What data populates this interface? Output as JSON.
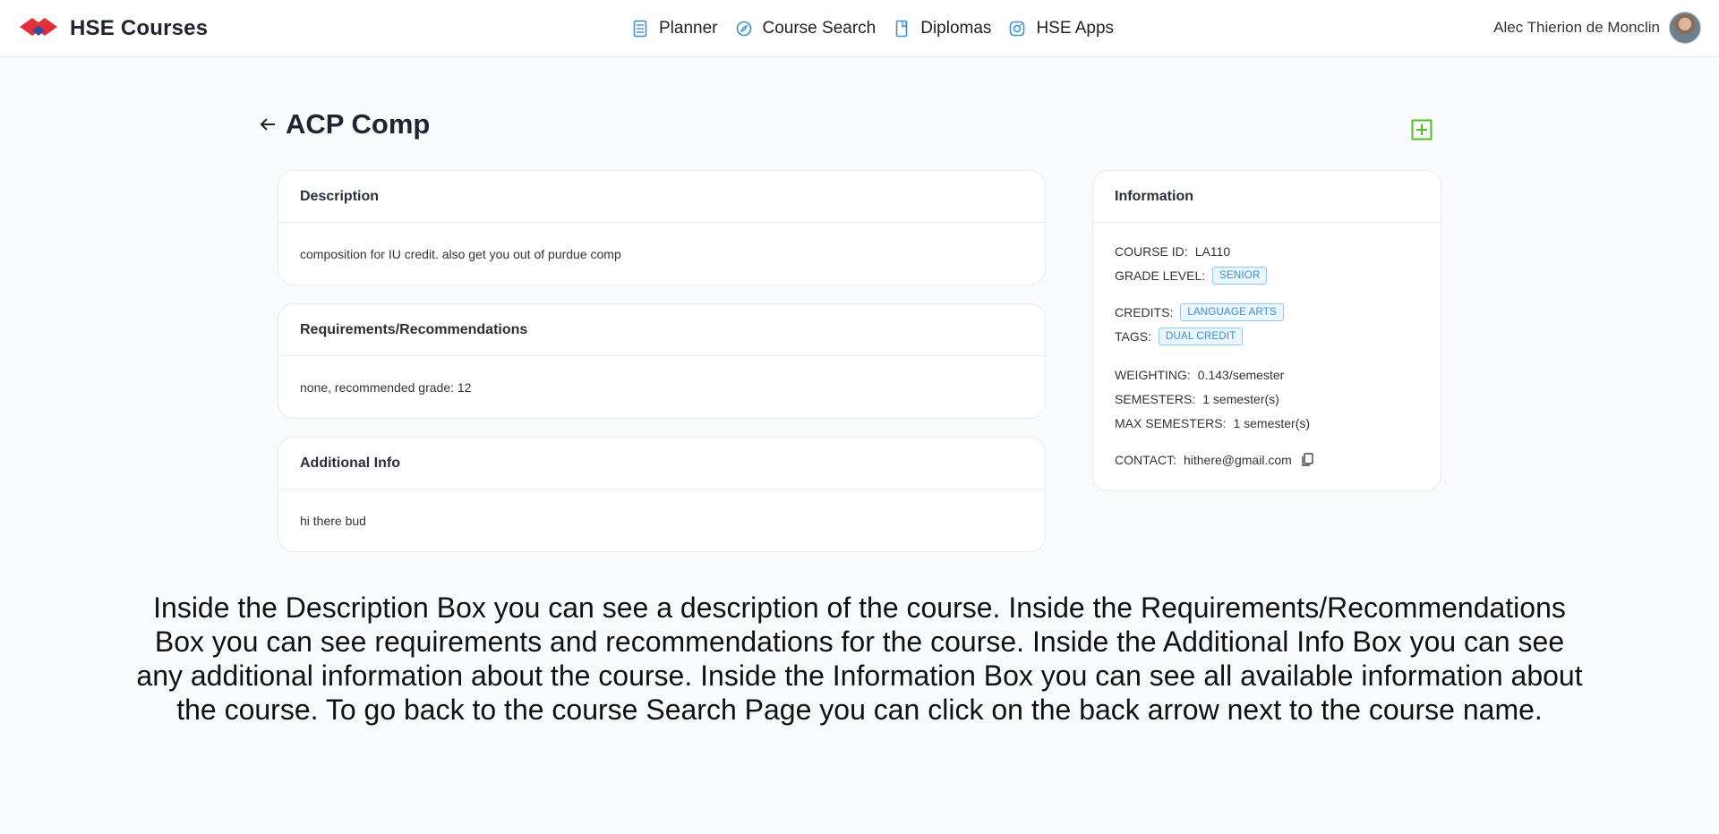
{
  "header": {
    "brand_name": "HSE Courses",
    "nav": [
      {
        "label": "Planner",
        "icon": "book-icon"
      },
      {
        "label": "Course Search",
        "icon": "compass-icon"
      },
      {
        "label": "Diplomas",
        "icon": "bookmark-icon"
      },
      {
        "label": "HSE Apps",
        "icon": "instagram-icon"
      }
    ],
    "user_name": "Alec Thierion de Monclin"
  },
  "page": {
    "title": "ACP Comp"
  },
  "cards": {
    "description": {
      "title": "Description",
      "body": "composition for IU credit. also get you out of purdue comp"
    },
    "requirements": {
      "title": "Requirements/Recommendations",
      "body": "none, recommended grade: 12"
    },
    "additional": {
      "title": "Additional Info",
      "body": "hi there bud"
    }
  },
  "info": {
    "title": "Information",
    "course_id_label": "COURSE ID:",
    "course_id": "LA110",
    "grade_level_label": "GRADE LEVEL:",
    "grade_level": "SENIOR",
    "credits_label": "CREDITS:",
    "credits": "LANGUAGE ARTS",
    "tags_label": "TAGS:",
    "tags": "DUAL CREDIT",
    "weighting_label": "WEIGHTING:",
    "weighting": "0.143/semester",
    "semesters_label": "SEMESTERS:",
    "semesters": "1 semester(s)",
    "max_semesters_label": "MAX SEMESTERS:",
    "max_semesters": "1 semester(s)",
    "contact_label": "CONTACT:",
    "contact": "hithere@gmail.com"
  },
  "caption": "Inside the Description Box you can see a description of the course. Inside the Requirements/Recommendations Box you can see requirements and recommendations for the course. Inside the Additional Info Box you can see any additional information about the course. Inside the Information Box you can see all available information about the course. To go back to the course Search Page you can click on the back arrow next to the course name.",
  "colors": {
    "accent": "#3b8fd6",
    "brand_red": "#e0303a",
    "brand_blue": "#2a4fa8",
    "add_green": "#54c01f"
  }
}
